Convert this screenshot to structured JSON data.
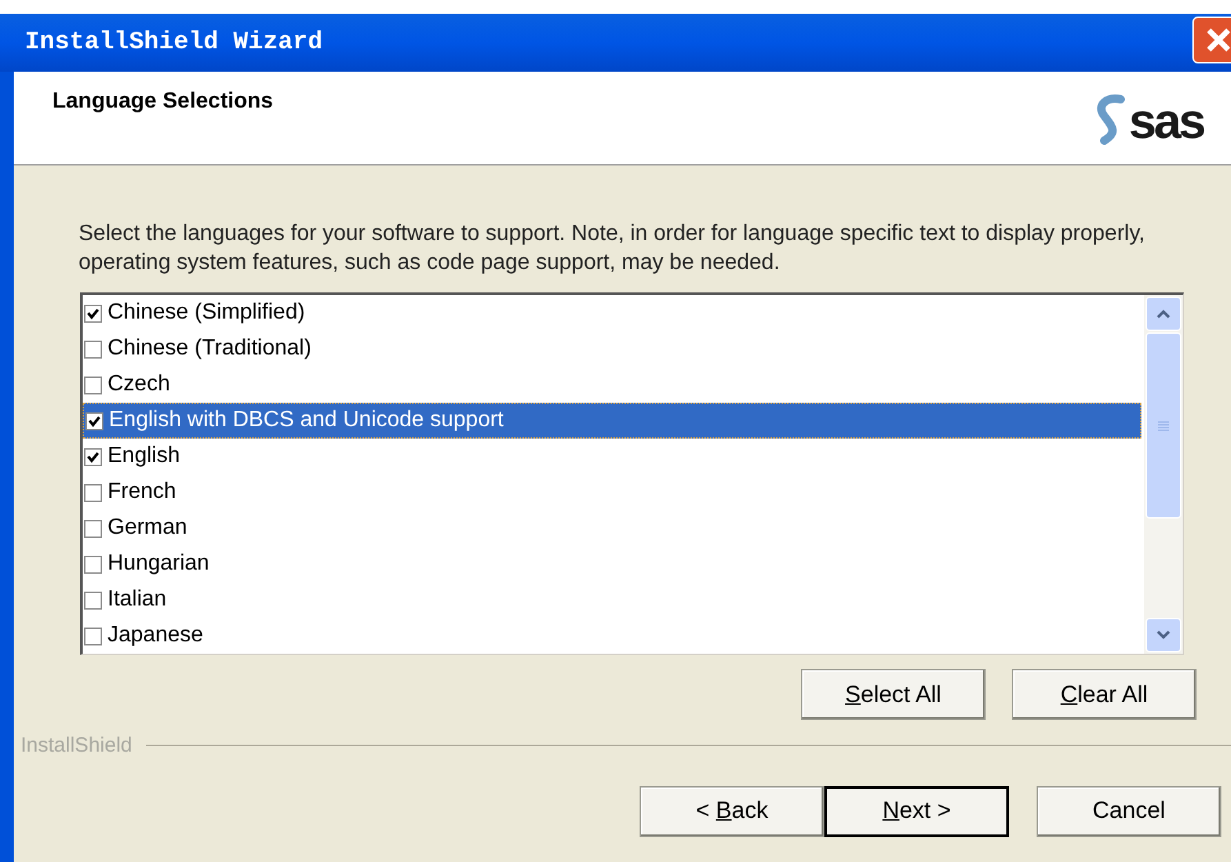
{
  "window": {
    "title": "InstallShield Wizard"
  },
  "header": {
    "title": "Language Selections",
    "logo_text": "sas"
  },
  "description": "Select the languages for your software to support.  Note, in order for language specific text to display properly, operating system features, such as code page support, may be needed.",
  "languages": [
    {
      "label": "Chinese (Simplified)",
      "checked": true,
      "selected": false
    },
    {
      "label": "Chinese (Traditional)",
      "checked": false,
      "selected": false
    },
    {
      "label": "Czech",
      "checked": false,
      "selected": false
    },
    {
      "label": "English with DBCS and Unicode support",
      "checked": true,
      "selected": true
    },
    {
      "label": "English",
      "checked": true,
      "selected": false
    },
    {
      "label": "French",
      "checked": false,
      "selected": false
    },
    {
      "label": "German",
      "checked": false,
      "selected": false
    },
    {
      "label": "Hungarian",
      "checked": false,
      "selected": false
    },
    {
      "label": "Italian",
      "checked": false,
      "selected": false
    },
    {
      "label": "Japanese",
      "checked": false,
      "selected": false
    }
  ],
  "list_buttons": [
    {
      "key": "S",
      "after": "elect All"
    },
    {
      "key": "C",
      "after": "lear All"
    }
  ],
  "brand": "InstallShield",
  "nav_buttons": [
    {
      "before": "< ",
      "key": "B",
      "after": "ack",
      "default": false
    },
    {
      "key": "N",
      "after": "ext >",
      "default": true
    },
    {
      "after": "Cancel",
      "default": false
    }
  ]
}
